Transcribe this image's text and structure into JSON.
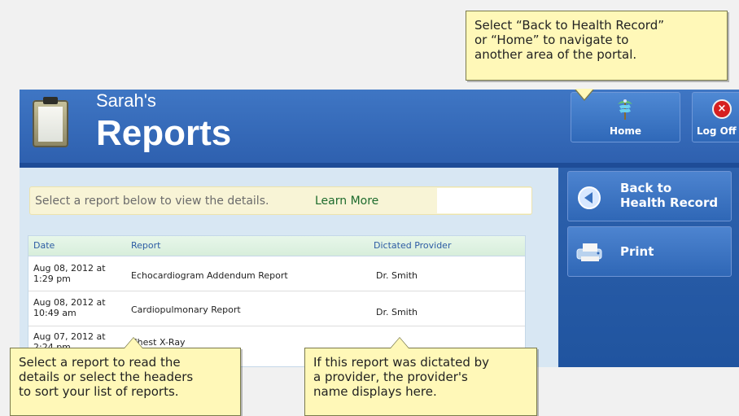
{
  "header": {
    "owner_name": "Sarah's",
    "page_title": "Reports",
    "home_label": "Home",
    "logoff_label": "Log Off"
  },
  "info": {
    "text": "Select a report below to view the details.",
    "link": "Learn More"
  },
  "table": {
    "headers": [
      "Date",
      "Report",
      "Dictated Provider"
    ],
    "rows": [
      {
        "date": "Aug 08, 2012 at\n1:29 pm",
        "report": "Echocardiogram Addendum Report",
        "provider": "Dr. Smith"
      },
      {
        "date": "Aug 08, 2012 at\n10:49 am",
        "report": "Cardiopulmonary Report",
        "provider": "Dr. Smith"
      },
      {
        "date": "Aug 07, 2012 at\n2:24 pm",
        "report": "Chest X-Ray",
        "provider": ""
      }
    ]
  },
  "sidebar": {
    "back_label": "Back to\nHealth Record",
    "print_label": "Print"
  },
  "callouts": {
    "top": "Select “Back to Health Record”\nor “Home” to navigate to\nanother area of the portal.",
    "bottom_left": "Select a report to read the\ndetails or select the headers\nto sort your list of reports.",
    "bottom_right": "If this report was dictated by\na provider, the provider's\nname displays here."
  },
  "colors": {
    "header_blue": "#2d5fae",
    "panel_blue": "#20549f",
    "callout_yellow": "#fff8b8",
    "learn_more_green": "#1d6b2d"
  },
  "icons": {
    "app_icon": "clipboard-icon",
    "home_icon": "caduceus-icon",
    "logoff_icon": "close-icon",
    "back_icon": "back-arrow-icon",
    "print_icon": "printer-icon"
  }
}
